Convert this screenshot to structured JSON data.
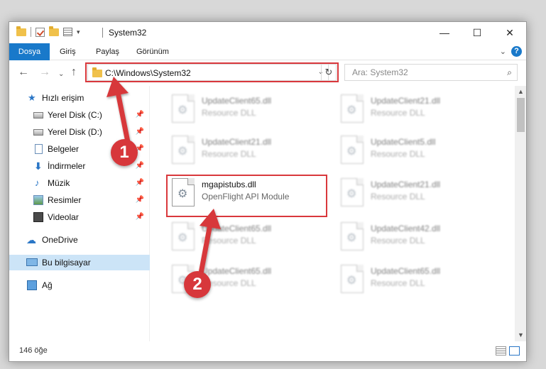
{
  "window": {
    "title": "System32",
    "controls": {
      "minimize": "—",
      "maximize": "☐",
      "close": "✕"
    }
  },
  "ribbon": {
    "tabs": [
      "Dosya",
      "Giriş",
      "Paylaş",
      "Görünüm"
    ],
    "help": "?"
  },
  "address": {
    "path": "C:\\Windows\\System32",
    "search_placeholder": "Ara: System32"
  },
  "sidebar": {
    "quick_access": "Hızlı erişim",
    "items": [
      {
        "label": "Yerel Disk (C:)",
        "icon": "drive-icon"
      },
      {
        "label": "Yerel Disk (D:)",
        "icon": "drive-icon"
      },
      {
        "label": "Belgeler",
        "icon": "documents-icon"
      },
      {
        "label": "İndirmeler",
        "icon": "downloads-icon"
      },
      {
        "label": "Müzik",
        "icon": "music-icon"
      },
      {
        "label": "Resimler",
        "icon": "pictures-icon"
      },
      {
        "label": "Videolar",
        "icon": "videos-icon"
      }
    ],
    "onedrive": "OneDrive",
    "this_pc": "Bu bilgisayar",
    "network": "Ağ"
  },
  "files": {
    "left": [
      {
        "name": "UpdateClient65.dll",
        "desc": "Resource DLL"
      },
      {
        "name": "UpdateClient21.dll",
        "desc": "Resource DLL"
      },
      {
        "name": "mgapistubs.dll",
        "desc": "OpenFlight API Module"
      },
      {
        "name": "UpdateClient65.dll",
        "desc": "Resource DLL"
      },
      {
        "name": "UpdateClient65.dll",
        "desc": "Resource DLL"
      }
    ],
    "right": [
      {
        "name": "UpdateClient21.dll",
        "desc": "Resource DLL"
      },
      {
        "name": "UpdateClient5.dll",
        "desc": "Resource DLL"
      },
      {
        "name": "UpdateClient21.dll",
        "desc": "Resource DLL"
      },
      {
        "name": "UpdateClient42.dll",
        "desc": "Resource DLL"
      },
      {
        "name": "UpdateClient65.dll",
        "desc": "Resource DLL"
      }
    ]
  },
  "status": {
    "count": "146 öğe"
  },
  "annotations": {
    "step1": "1",
    "step2": "2"
  },
  "colors": {
    "accent": "#1979ca",
    "annotation_red": "#d7373b",
    "selected": "#cce4f7"
  }
}
